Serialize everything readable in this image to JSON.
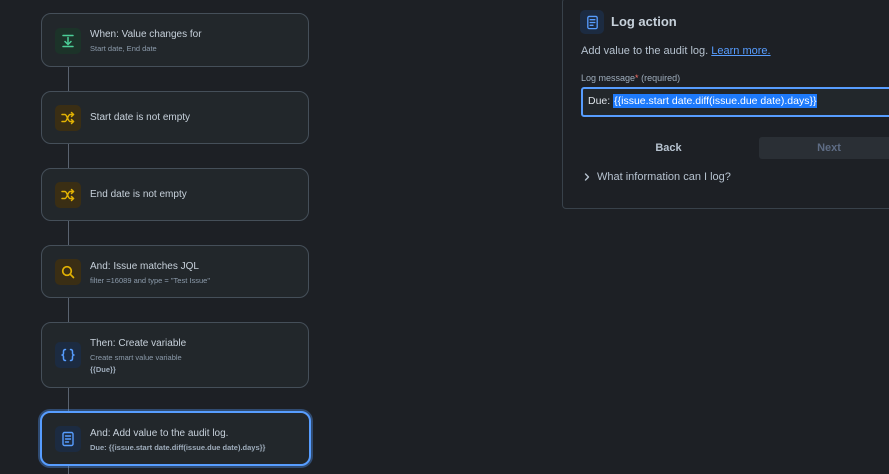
{
  "rules": [
    {
      "title": "When: Value changes for",
      "subtitle": "Start date, End date",
      "icon": "download-arrow-icon"
    },
    {
      "title": "Start date is not empty",
      "icon": "shuffle-icon"
    },
    {
      "title": "End date is not empty",
      "icon": "shuffle-icon"
    },
    {
      "title": "And: Issue matches JQL",
      "subtitle": "filter =16089 and type = \"Test Issue\"",
      "icon": "search-icon"
    },
    {
      "title": "Then: Create variable",
      "subtitle": "Create smart value variable",
      "subtitle2": "{{Due}}",
      "icon": "braces-icon"
    },
    {
      "title": "And: Add value to the audit log.",
      "subtitle": "Due: {{issue.start date.diff(issue.due date).days}}",
      "icon": "log-icon"
    }
  ],
  "panel": {
    "title": "Log action",
    "description": "Add value to the audit log.",
    "learn_more": "Learn more.",
    "field_label": "Log message",
    "required_mark": "*",
    "required_text": "(required)",
    "input_prefix": "Due: ",
    "input_selected": "{{issue.start date.diff(issue.due date).days}}",
    "back_label": "Back",
    "next_label": "Next",
    "expander_label": "What information can I log?"
  },
  "colors": {
    "background": "#1d2025",
    "accent": "#579dff",
    "green_icon": "#4bce97",
    "yellow_icon": "#e2b203",
    "blue_icon": "#579dff"
  }
}
